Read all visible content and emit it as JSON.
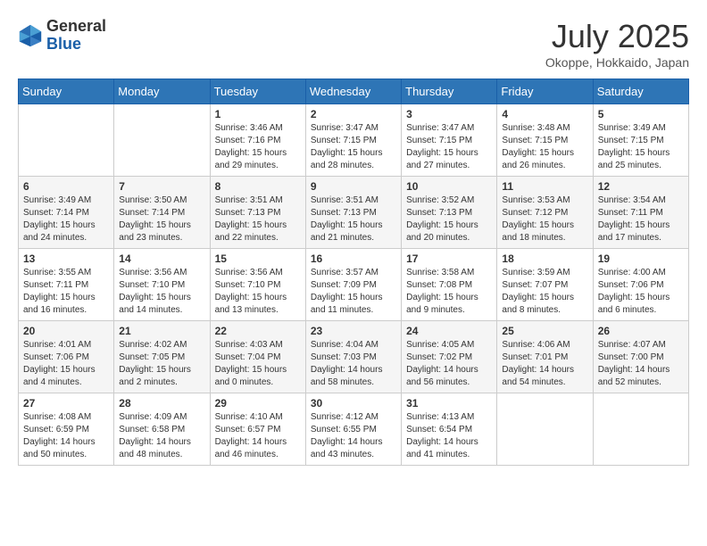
{
  "header": {
    "logo": {
      "general": "General",
      "blue": "Blue"
    },
    "title": "July 2025",
    "location": "Okoppe, Hokkaido, Japan"
  },
  "weekdays": [
    "Sunday",
    "Monday",
    "Tuesday",
    "Wednesday",
    "Thursday",
    "Friday",
    "Saturday"
  ],
  "weeks": [
    [
      {
        "day": "",
        "info": ""
      },
      {
        "day": "",
        "info": ""
      },
      {
        "day": "1",
        "info": "Sunrise: 3:46 AM\nSunset: 7:16 PM\nDaylight: 15 hours\nand 29 minutes."
      },
      {
        "day": "2",
        "info": "Sunrise: 3:47 AM\nSunset: 7:15 PM\nDaylight: 15 hours\nand 28 minutes."
      },
      {
        "day": "3",
        "info": "Sunrise: 3:47 AM\nSunset: 7:15 PM\nDaylight: 15 hours\nand 27 minutes."
      },
      {
        "day": "4",
        "info": "Sunrise: 3:48 AM\nSunset: 7:15 PM\nDaylight: 15 hours\nand 26 minutes."
      },
      {
        "day": "5",
        "info": "Sunrise: 3:49 AM\nSunset: 7:15 PM\nDaylight: 15 hours\nand 25 minutes."
      }
    ],
    [
      {
        "day": "6",
        "info": "Sunrise: 3:49 AM\nSunset: 7:14 PM\nDaylight: 15 hours\nand 24 minutes."
      },
      {
        "day": "7",
        "info": "Sunrise: 3:50 AM\nSunset: 7:14 PM\nDaylight: 15 hours\nand 23 minutes."
      },
      {
        "day": "8",
        "info": "Sunrise: 3:51 AM\nSunset: 7:13 PM\nDaylight: 15 hours\nand 22 minutes."
      },
      {
        "day": "9",
        "info": "Sunrise: 3:51 AM\nSunset: 7:13 PM\nDaylight: 15 hours\nand 21 minutes."
      },
      {
        "day": "10",
        "info": "Sunrise: 3:52 AM\nSunset: 7:13 PM\nDaylight: 15 hours\nand 20 minutes."
      },
      {
        "day": "11",
        "info": "Sunrise: 3:53 AM\nSunset: 7:12 PM\nDaylight: 15 hours\nand 18 minutes."
      },
      {
        "day": "12",
        "info": "Sunrise: 3:54 AM\nSunset: 7:11 PM\nDaylight: 15 hours\nand 17 minutes."
      }
    ],
    [
      {
        "day": "13",
        "info": "Sunrise: 3:55 AM\nSunset: 7:11 PM\nDaylight: 15 hours\nand 16 minutes."
      },
      {
        "day": "14",
        "info": "Sunrise: 3:56 AM\nSunset: 7:10 PM\nDaylight: 15 hours\nand 14 minutes."
      },
      {
        "day": "15",
        "info": "Sunrise: 3:56 AM\nSunset: 7:10 PM\nDaylight: 15 hours\nand 13 minutes."
      },
      {
        "day": "16",
        "info": "Sunrise: 3:57 AM\nSunset: 7:09 PM\nDaylight: 15 hours\nand 11 minutes."
      },
      {
        "day": "17",
        "info": "Sunrise: 3:58 AM\nSunset: 7:08 PM\nDaylight: 15 hours\nand 9 minutes."
      },
      {
        "day": "18",
        "info": "Sunrise: 3:59 AM\nSunset: 7:07 PM\nDaylight: 15 hours\nand 8 minutes."
      },
      {
        "day": "19",
        "info": "Sunrise: 4:00 AM\nSunset: 7:06 PM\nDaylight: 15 hours\nand 6 minutes."
      }
    ],
    [
      {
        "day": "20",
        "info": "Sunrise: 4:01 AM\nSunset: 7:06 PM\nDaylight: 15 hours\nand 4 minutes."
      },
      {
        "day": "21",
        "info": "Sunrise: 4:02 AM\nSunset: 7:05 PM\nDaylight: 15 hours\nand 2 minutes."
      },
      {
        "day": "22",
        "info": "Sunrise: 4:03 AM\nSunset: 7:04 PM\nDaylight: 15 hours\nand 0 minutes."
      },
      {
        "day": "23",
        "info": "Sunrise: 4:04 AM\nSunset: 7:03 PM\nDaylight: 14 hours\nand 58 minutes."
      },
      {
        "day": "24",
        "info": "Sunrise: 4:05 AM\nSunset: 7:02 PM\nDaylight: 14 hours\nand 56 minutes."
      },
      {
        "day": "25",
        "info": "Sunrise: 4:06 AM\nSunset: 7:01 PM\nDaylight: 14 hours\nand 54 minutes."
      },
      {
        "day": "26",
        "info": "Sunrise: 4:07 AM\nSunset: 7:00 PM\nDaylight: 14 hours\nand 52 minutes."
      }
    ],
    [
      {
        "day": "27",
        "info": "Sunrise: 4:08 AM\nSunset: 6:59 PM\nDaylight: 14 hours\nand 50 minutes."
      },
      {
        "day": "28",
        "info": "Sunrise: 4:09 AM\nSunset: 6:58 PM\nDaylight: 14 hours\nand 48 minutes."
      },
      {
        "day": "29",
        "info": "Sunrise: 4:10 AM\nSunset: 6:57 PM\nDaylight: 14 hours\nand 46 minutes."
      },
      {
        "day": "30",
        "info": "Sunrise: 4:12 AM\nSunset: 6:55 PM\nDaylight: 14 hours\nand 43 minutes."
      },
      {
        "day": "31",
        "info": "Sunrise: 4:13 AM\nSunset: 6:54 PM\nDaylight: 14 hours\nand 41 minutes."
      },
      {
        "day": "",
        "info": ""
      },
      {
        "day": "",
        "info": ""
      }
    ]
  ]
}
